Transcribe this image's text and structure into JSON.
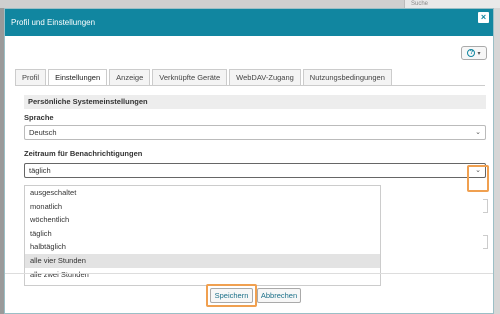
{
  "background": {
    "search_text": "Suche"
  },
  "dialog": {
    "title": "Profil und Einstellungen",
    "close_label": "×",
    "help_label": "?"
  },
  "tabs": [
    {
      "label": "Profil",
      "active": false
    },
    {
      "label": "Einstellungen",
      "active": true
    },
    {
      "label": "Anzeige",
      "active": false
    },
    {
      "label": "Verknüpfte Geräte",
      "active": false
    },
    {
      "label": "WebDAV-Zugang",
      "active": false
    },
    {
      "label": "Nutzungsbedingungen",
      "active": false
    }
  ],
  "section": {
    "title": "Persönliche Systemeinstellungen"
  },
  "language": {
    "label": "Sprache",
    "value": "Deutsch"
  },
  "notification": {
    "label": "Zeitraum für Benachrichtigungen",
    "value": "täglich",
    "options": [
      "ausgeschaltet",
      "monatlich",
      "wöchentlich",
      "täglich",
      "halbtäglich",
      "alle vier Stunden",
      "alle zwei Stunden"
    ],
    "highlighted_index": 5
  },
  "footer": {
    "save_label": "Speichern",
    "cancel_label": "Abbrechen"
  },
  "colors": {
    "titlebar": "#1186a0",
    "highlight": "#f0a050"
  }
}
